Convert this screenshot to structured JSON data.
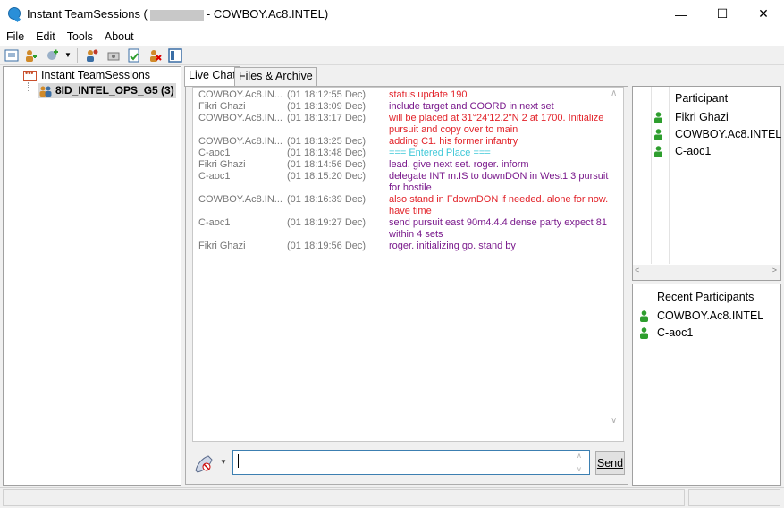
{
  "window": {
    "title_prefix": "Instant TeamSessions (",
    "title_suffix": "- COWBOY.Ac8.INTEL)",
    "minimize": "—",
    "maximize": "☐",
    "close": "✕"
  },
  "menu": [
    "File",
    "Edit",
    "Tools",
    "About"
  ],
  "toolbar_icons": [
    "session-list-icon",
    "add-user-icon",
    "add-dropdown-icon",
    "dropdown-arrow-icon",
    "users-icon",
    "broadcast-icon",
    "document-icon",
    "remove-user-icon",
    "panel-icon"
  ],
  "tree": {
    "root": "Instant TeamSessions",
    "child": "8ID_INTEL_OPS_G5 (3)"
  },
  "tabs": [
    "Live Chat",
    "Files & Archive"
  ],
  "messages": [
    {
      "who": "COWBOY.Ac8.IN...",
      "when": "(01 18:12:55 Dec)",
      "text": "status update 190",
      "color": "red"
    },
    {
      "who": "Fikri Ghazi",
      "when": "(01 18:13:09 Dec)",
      "text": "include target and COORD in next set",
      "color": "purple"
    },
    {
      "who": "COWBOY.Ac8.IN...",
      "when": "(01 18:13:17 Dec)",
      "text": " will be placed at 31°24'12.2\"N 2 at 1700. Initialize pursuit and copy over to main",
      "color": "red"
    },
    {
      "who": "COWBOY.Ac8.IN...",
      "when": "(01 18:13:25 Dec)",
      "text": "adding C1. his former infantry",
      "color": "red"
    },
    {
      "who": "C-aoc1",
      "when": "(01 18:13:48 Dec)",
      "text": "=== Entered Place ===",
      "color": "cyan"
    },
    {
      "who": "Fikri Ghazi",
      "when": "(01 18:14:56 Dec)",
      "text": "lead. give next set. roger. inform",
      "color": "purple"
    },
    {
      "who": "C-aoc1",
      "when": "(01 18:15:20 Dec)",
      "text": " delegate INT m.IS to downDON in West1 3 pursuit for hostile",
      "color": "purple"
    },
    {
      "who": "COWBOY.Ac8.IN...",
      "when": "(01 18:16:39 Dec)",
      "text": " also stand in FdownDON if needed. alone for now. have time",
      "color": "red"
    },
    {
      "who": "C-aoc1",
      "when": "(01 18:19:27 Dec)",
      "text": " send pursuit east 90m4.4.4 dense party expect 81 within 4 sets",
      "color": "purple"
    },
    {
      "who": "Fikri Ghazi",
      "when": "(01 18:19:56 Dec)",
      "text": "roger. initializing go. stand by",
      "color": "purple"
    }
  ],
  "input": {
    "value": "",
    "send_label": "Send"
  },
  "participants": {
    "header": "Participant",
    "items": [
      "Fikri Ghazi",
      "COWBOY.Ac8.INTEL",
      "C-aoc1"
    ]
  },
  "recent": {
    "header": "Recent Participants",
    "items": [
      "COWBOY.Ac8.INTEL",
      "C-aoc1"
    ]
  },
  "colors": {
    "red": "#e2232a",
    "purple": "#7a1a8c",
    "cyan": "#3fc8d8",
    "person": "#2e9e2e"
  }
}
